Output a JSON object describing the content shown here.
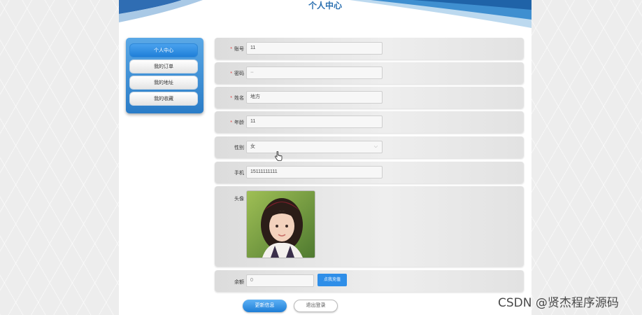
{
  "header": {
    "title": "个人中心"
  },
  "sidebar": {
    "items": [
      {
        "label": "个人中心",
        "active": true
      },
      {
        "label": "我的订单",
        "active": false
      },
      {
        "label": "我的地址",
        "active": false
      },
      {
        "label": "我的收藏",
        "active": false
      }
    ]
  },
  "form": {
    "account": {
      "label": "账号",
      "required": "*",
      "value": "11"
    },
    "password": {
      "label": "密码",
      "required": "*",
      "value": "··"
    },
    "name": {
      "label": "姓名",
      "required": "*",
      "value": "地方"
    },
    "age": {
      "label": "年龄",
      "required": "*",
      "value": "11"
    },
    "gender": {
      "label": "性别",
      "value": "女"
    },
    "phone": {
      "label": "手机",
      "value": "15111111111"
    },
    "avatar": {
      "label": "头像"
    },
    "balance": {
      "label": "余额",
      "value": "0",
      "recharge_label": "点我充值"
    }
  },
  "actions": {
    "update_label": "更新信息",
    "logout_label": "退出登录"
  },
  "watermark": "CSDN @贤杰程序源码",
  "colors": {
    "accent": "#1e7ed6",
    "required": "#e03b3b"
  }
}
